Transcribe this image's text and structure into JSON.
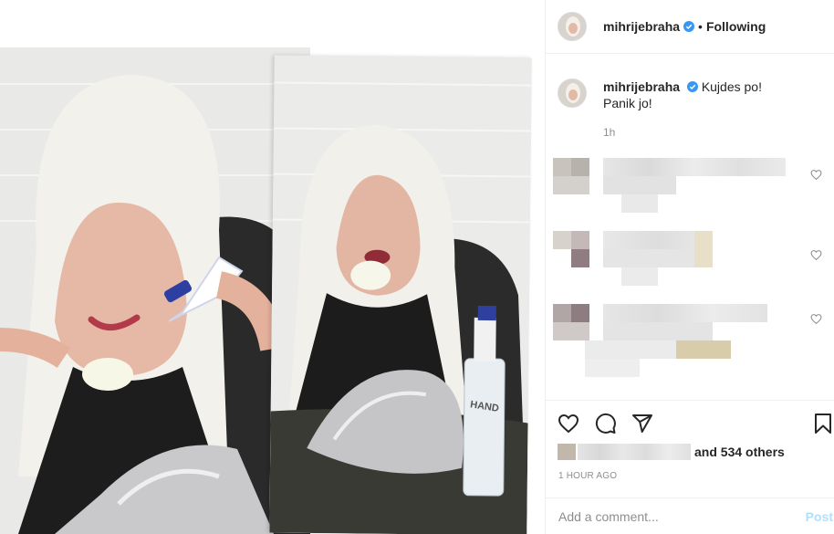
{
  "header": {
    "username": "mihrijebraha",
    "separator": "•",
    "follow_status": "Following"
  },
  "caption": {
    "username": "mihrijebraha",
    "line1": "Kujdes po!",
    "line2": "Panik jo!",
    "time": "1h"
  },
  "photo": {
    "bottle_label": "HAND"
  },
  "likes": {
    "others_text": "and 534 others"
  },
  "timestamp": "1 HOUR AGO",
  "comment_box": {
    "placeholder": "Add a comment...",
    "post_label": "Post"
  },
  "colors": {
    "verified_blue": "#3897f0",
    "post_disabled": "#b2dffc",
    "secondary_text": "#8e8e8e"
  },
  "icons": [
    "verified-badge-icon",
    "heart-icon",
    "comment-icon",
    "share-icon",
    "bookmark-icon",
    "small-heart-icon"
  ]
}
